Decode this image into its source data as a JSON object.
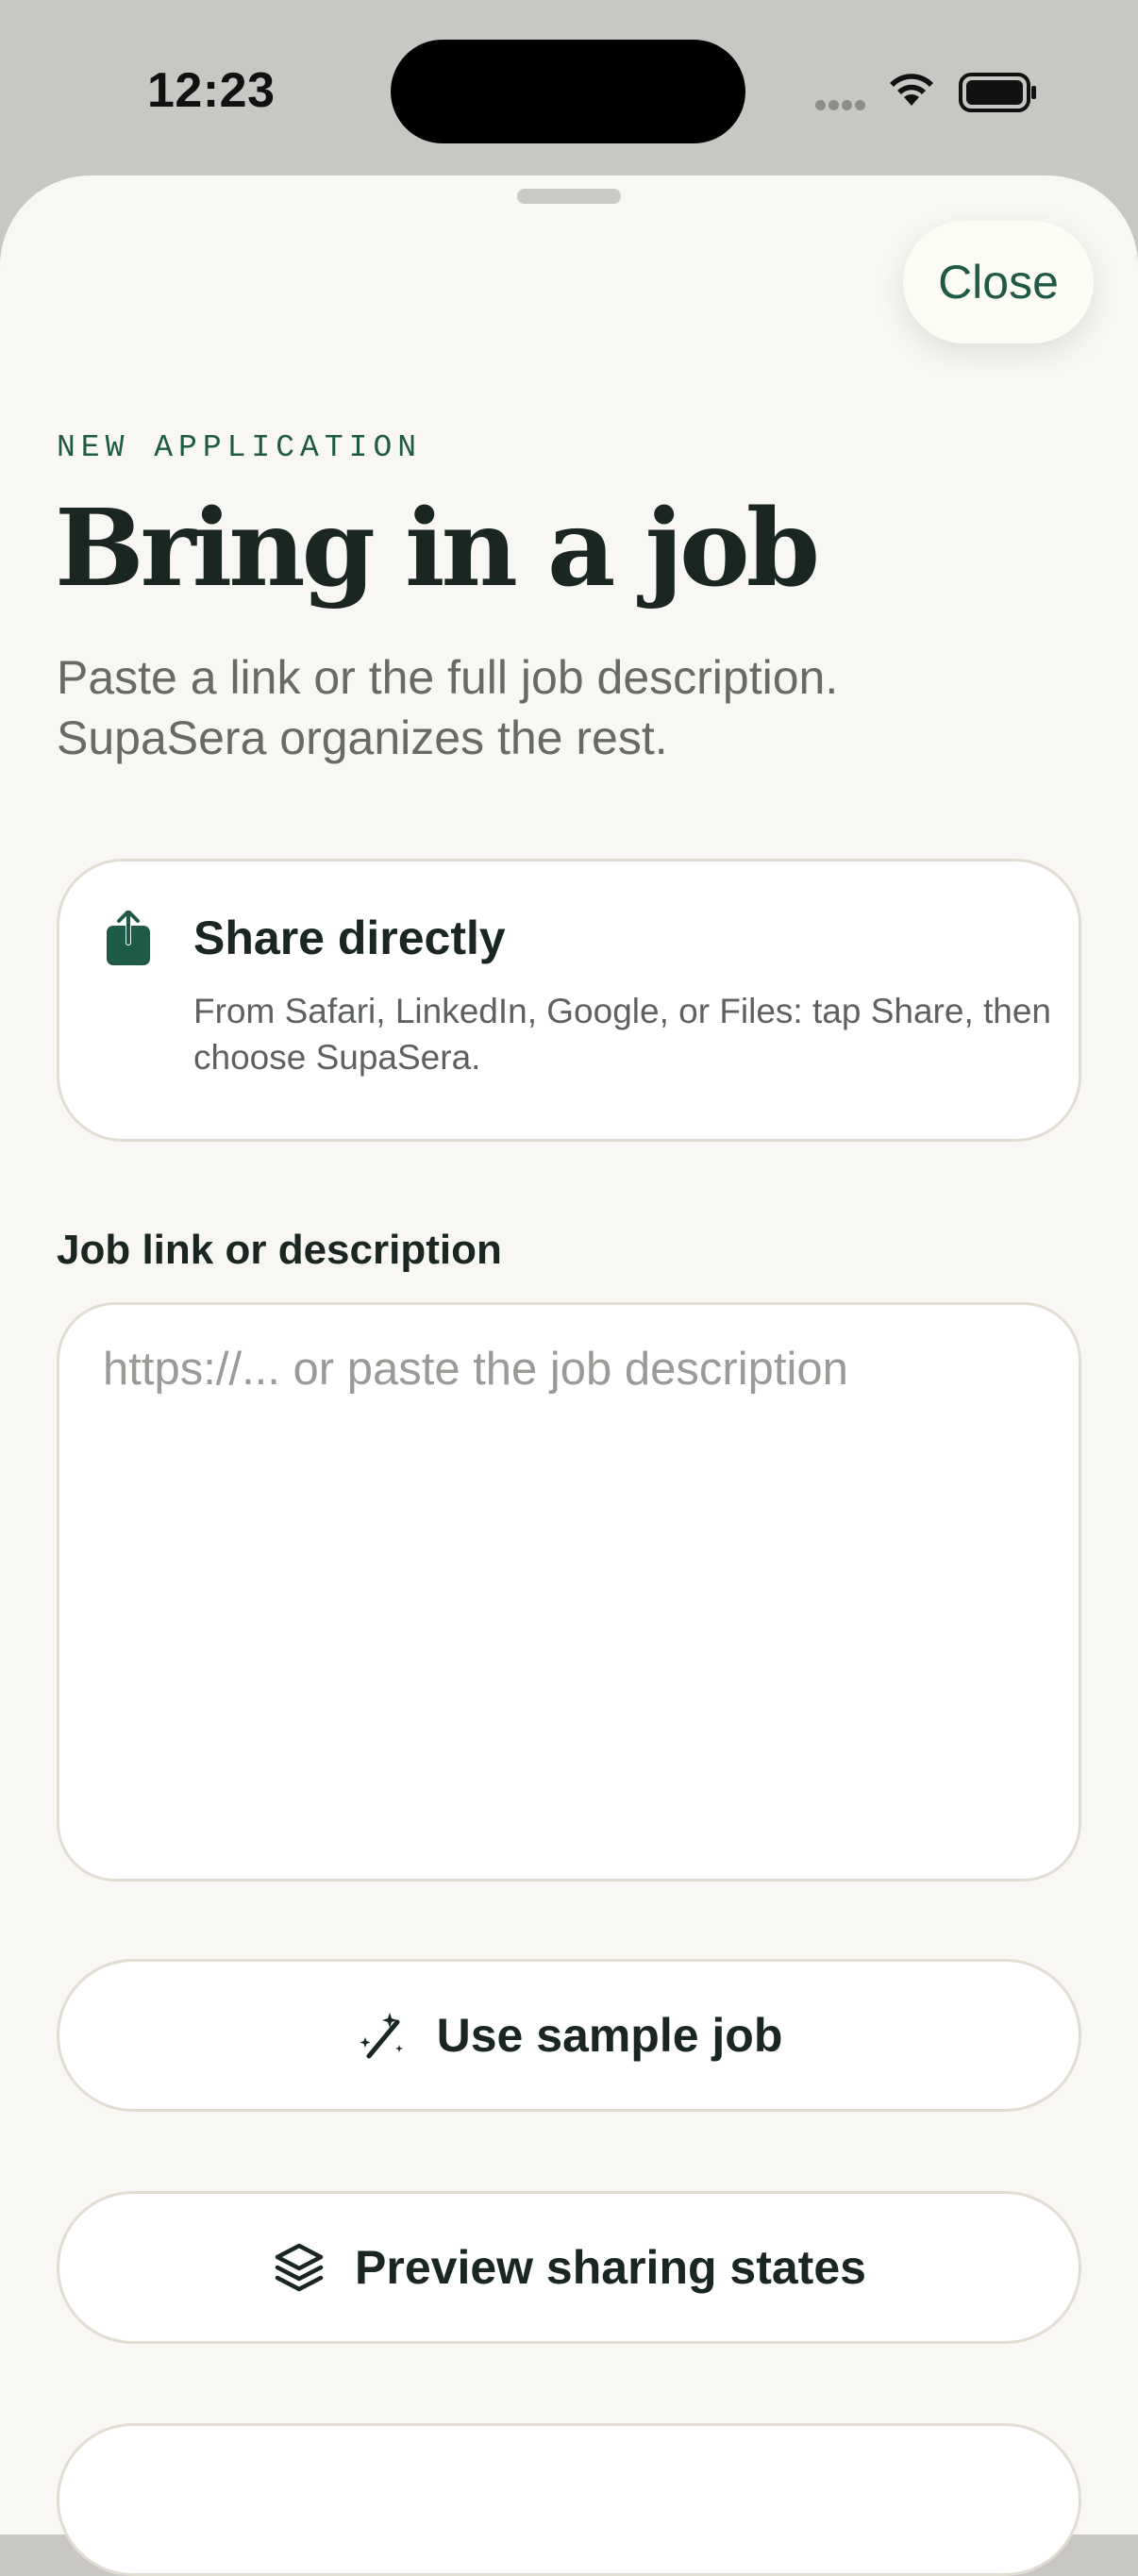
{
  "status_bar": {
    "time": "12:23"
  },
  "header": {
    "close_label": "Close",
    "eyebrow": "NEW APPLICATION",
    "title": "Bring in a job",
    "subtitle": "Paste a link or the full job description. SupaSera organizes the rest."
  },
  "share_card": {
    "title": "Share directly",
    "description": "From Safari, LinkedIn, Google, or Files: tap Share, then choose SupaSera.",
    "icon": "share-icon"
  },
  "job_input": {
    "label": "Job link or description",
    "placeholder": "https://... or paste the job description",
    "value": ""
  },
  "actions": {
    "sample_label": "Use sample job",
    "sample_icon": "magic-wand-icon",
    "preview_label": "Preview sharing states",
    "preview_icon": "stack-icon"
  },
  "colors": {
    "accent": "#1e5a45",
    "background": "#f8f7f3",
    "text": "#1a2621"
  }
}
